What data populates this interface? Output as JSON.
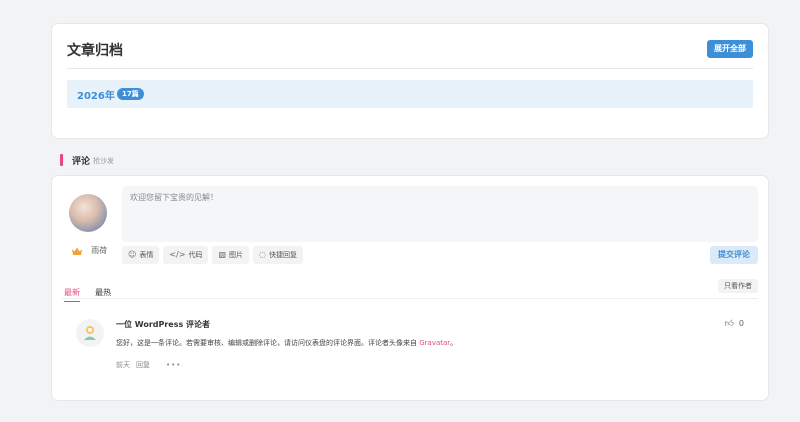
{
  "archive": {
    "title": "文章归档",
    "expand_label": "展开全部",
    "year": "2026年",
    "year_count": "17篇"
  },
  "comments_section": {
    "title": "评论",
    "subtitle": "抢沙发"
  },
  "comment_form": {
    "user_name": "雨荷",
    "placeholder": "欢迎您留下宝贵的见解！",
    "tools": [
      {
        "icon": "emoji-icon",
        "label": "表情"
      },
      {
        "icon": "code-icon",
        "label": "代码"
      },
      {
        "icon": "image-icon",
        "label": "图片"
      },
      {
        "icon": "quick-reply-icon",
        "label": "快捷回复"
      }
    ],
    "submit_label": "提交评论"
  },
  "sort": {
    "tabs": [
      "最新",
      "最热"
    ],
    "active": "最新",
    "author_only_label": "只看作者"
  },
  "comment": {
    "author": "一位 WordPress 评论者",
    "likes": "0",
    "text_before": "您好，这是一条评论。若需要审核、编辑或删除评论，请访问仪表盘的评论界面。评论者头像来自",
    "link_text": "Gravatar",
    "text_after": "。",
    "time": "前天",
    "reply_label": "回复",
    "more_label": "•••"
  },
  "colors": {
    "accent_blue": "#3d8fd8",
    "accent_pink": "#e8467d",
    "background": "#f2f3f5"
  }
}
